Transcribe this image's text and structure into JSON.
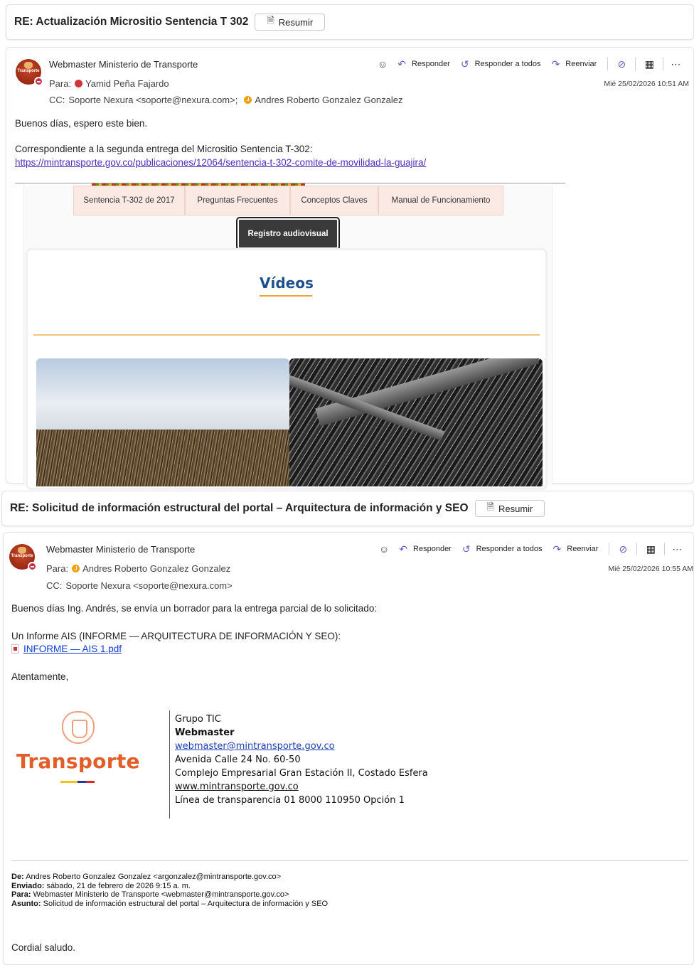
{
  "email1": {
    "subject": "RE: Actualización Micrositio Sentencia T 302",
    "resumir_label": "Resumir",
    "sender": "Webmaster Ministerio de Transporte",
    "avatar_text": "Transporte",
    "to_label": "Para:",
    "to_name": "Yamid Peña Fajardo",
    "cc_label": "CC:",
    "cc_value": "Soporte Nexura <soporte@nexura.com>;",
    "cc_name2": "Andres Roberto Gonzalez Gonzalez",
    "reply": "Responder",
    "reply_all": "Responder a todos",
    "forward": "Reenviar",
    "timestamp": "Mié 25/02/2026 10:51 AM",
    "greeting": "Buenos días, espero este bien.",
    "line2": "Correspondiente a la segunda entrega del Micrositio Sentencia T-302:",
    "url": "https://mintransporte.gov.co/publicaciones/12064/sentencia-t-302-comite-de-movilidad-la-guajira/",
    "site": {
      "tabs": [
        "Sentencia T-302 de 2017",
        "Preguntas Frecuentes",
        "Conceptos Claves",
        "Manual de Funcionamiento"
      ],
      "active_tab": "Registro audiovisual",
      "videos_title": "Vídeos"
    }
  },
  "email2": {
    "subject": "RE: Solicitud de información estructural del portal – Arquitectura de información y SEO",
    "resumir_label": "Resumir",
    "sender": "Webmaster Ministerio de Transporte",
    "avatar_text": "Transporte",
    "to_label": "Para:",
    "to_name": "Andres Roberto Gonzalez Gonzalez",
    "cc_label": "CC:",
    "cc_value": "Soporte Nexura <soporte@nexura.com>",
    "reply": "Responder",
    "reply_all": "Responder a todos",
    "forward": "Reenviar",
    "timestamp": "Mié 25/02/2026 10:55 AM",
    "greeting": "Buenos días Ing. Andrés, se envía un borrador para la entrega parcial de lo solicitado:",
    "line2": "Un Informe AIS (INFORME — ARQUITECTURA DE INFORMACIÓN Y SEO):",
    "attachment": "INFORME — AIS 1.pdf",
    "closing": "Atentamente,",
    "logo_word": "Transporte",
    "signature": {
      "group": "Grupo TIC",
      "title": "Webmaster",
      "email": "webmaster@mintransporte.gov.co",
      "address1": "Avenida Calle 24 No. 60-50",
      "address2": "Complejo Empresarial Gran Estación II, Costado Esfera",
      "website": "www.mintransporte.gov.co",
      "phone": "Línea de transparencia 01 8000 110950 Opción 1"
    },
    "quoted": {
      "from_label": "De:",
      "from": "Andres Roberto Gonzalez Gonzalez <argonzalez@mintransporte.gov.co>",
      "sent_label": "Enviado:",
      "sent": "sábado, 21 de febrero de 2026 9:15 a. m.",
      "to_label": "Para:",
      "to": "Webmaster Ministerio de Transporte <webmaster@mintransporte.gov.co>",
      "subject_label": "Asunto:",
      "subject": "Solicitud de información estructural del portal – Arquitectura de información y SEO"
    },
    "cordial": "Cordial saludo."
  },
  "icons": {
    "summarize": "summarize-icon",
    "emoji": "emoji-icon",
    "reply": "reply-arrow-icon",
    "reply_all": "reply-all-arrow-icon",
    "forward": "forward-arrow-icon",
    "loop": "loop-icon",
    "apps": "apps-grid-icon",
    "more": "more-ellipsis-icon",
    "attachment": "pdf-file-icon"
  },
  "colors": {
    "accent": "#5b5fc7",
    "link_visited": "#4f2dbf",
    "link": "#0f3dd6",
    "presence_busy": "#c4314b",
    "brand_orange": "#e35d2a",
    "videos_title": "#1d4f8f"
  }
}
